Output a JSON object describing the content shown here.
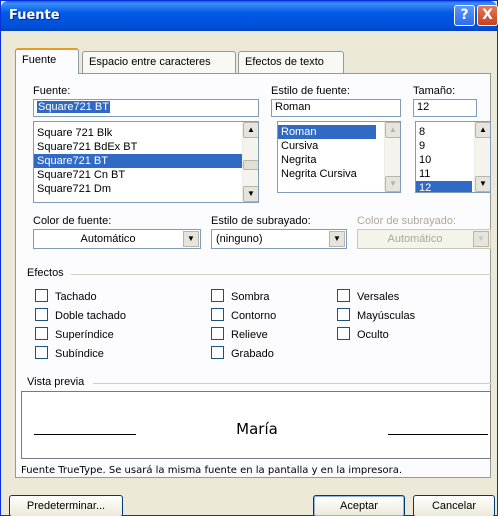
{
  "window": {
    "title": "Fuente",
    "help_label": "?",
    "close_label": "X"
  },
  "tabs": [
    {
      "label": "Fuente",
      "active": true
    },
    {
      "label": "Espacio entre caracteres",
      "active": false
    },
    {
      "label": "Efectos de texto",
      "active": false
    }
  ],
  "font": {
    "label": "Fuente:",
    "value": "Square721 BT",
    "items": [
      "Square 721 Blk",
      "Square721 BdEx BT",
      "Square721 BT",
      "Square721 Cn BT",
      "Square721 Dm"
    ],
    "selected_index": 2
  },
  "style": {
    "label": "Estilo de fuente:",
    "value": "Roman",
    "items": [
      "Roman",
      "Cursiva",
      "Negrita",
      "Negrita Cursiva"
    ],
    "selected_index": 0
  },
  "size": {
    "label": "Tamaño:",
    "value": "12",
    "items": [
      "8",
      "9",
      "10",
      "11",
      "12"
    ],
    "selected_index": 4
  },
  "font_color": {
    "label": "Color de fuente:",
    "value": "Automático"
  },
  "underline_style": {
    "label": "Estilo de subrayado:",
    "value": "(ninguno)"
  },
  "underline_color": {
    "label": "Color de subrayado:",
    "value": "Automático"
  },
  "effects": {
    "label": "Efectos",
    "items": [
      {
        "label": "Tachado",
        "checked": false
      },
      {
        "label": "Doble tachado",
        "checked": false
      },
      {
        "label": "Superíndice",
        "checked": false
      },
      {
        "label": "Subíndice",
        "checked": false
      },
      {
        "label": "Sombra",
        "checked": false
      },
      {
        "label": "Contorno",
        "checked": false
      },
      {
        "label": "Relieve",
        "checked": false
      },
      {
        "label": "Grabado",
        "checked": false
      },
      {
        "label": "Versales",
        "checked": false
      },
      {
        "label": "Mayúsculas",
        "checked": false
      },
      {
        "label": "Oculto",
        "checked": false
      }
    ]
  },
  "preview": {
    "label": "Vista previa",
    "text": "María"
  },
  "note": "Fuente TrueType. Se usará la misma fuente en la pantalla y en la impresora.",
  "buttons": {
    "default": "Predeterminar...",
    "ok": "Aceptar",
    "cancel": "Cancelar"
  }
}
